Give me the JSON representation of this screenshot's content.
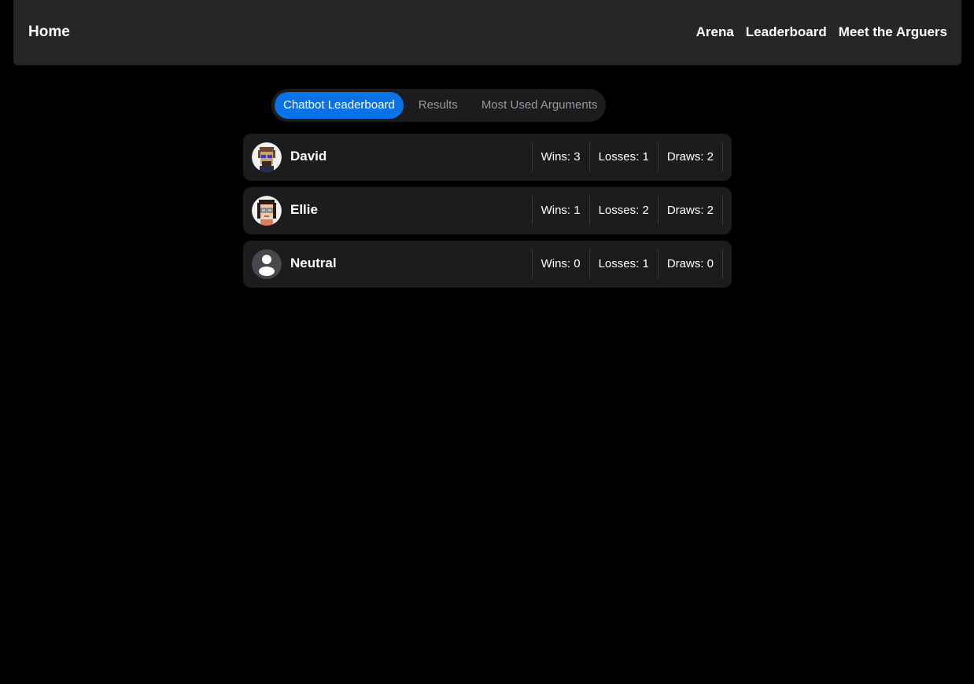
{
  "nav": {
    "home": "Home",
    "links": [
      "Arena",
      "Leaderboard",
      "Meet the Arguers"
    ]
  },
  "tabs": [
    {
      "label": "Chatbot Leaderboard",
      "active": true
    },
    {
      "label": "Results",
      "active": false
    },
    {
      "label": "Most Used Arguments",
      "active": false
    }
  ],
  "leaderboard": [
    {
      "name": "David",
      "avatar": "david-avatar-icon",
      "wins": "Wins: 3",
      "losses": "Losses: 1",
      "draws": "Draws: 2"
    },
    {
      "name": "Ellie",
      "avatar": "ellie-avatar-icon",
      "wins": "Wins: 1",
      "losses": "Losses: 2",
      "draws": "Draws: 2"
    },
    {
      "name": "Neutral",
      "avatar": "user-placeholder-icon",
      "wins": "Wins: 0",
      "losses": "Losses: 1",
      "draws": "Draws: 0"
    }
  ],
  "colors": {
    "accent": "#0a72e8",
    "navbar": "#262628",
    "card": "#1c1c1e",
    "background": "#000000"
  }
}
